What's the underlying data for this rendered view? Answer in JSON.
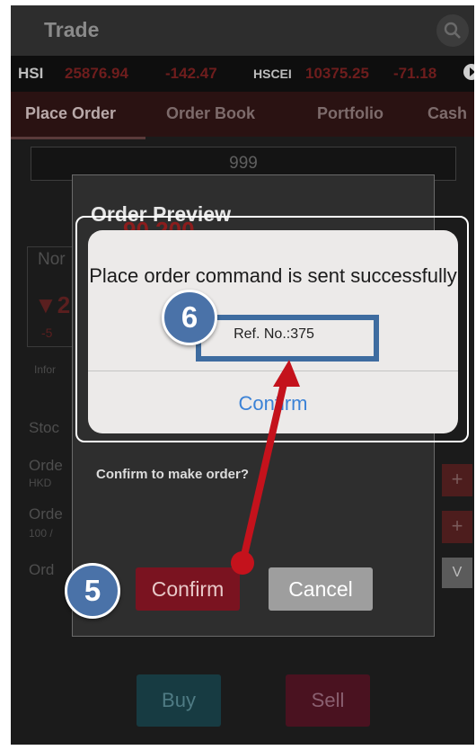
{
  "header": {
    "title": "Trade",
    "search_icon": "search-icon"
  },
  "ticker": {
    "hsi_label": "HSI",
    "hsi_value": "25876.94",
    "hsi_change": "-142.47",
    "hscei_label": "HSCEI",
    "hscei_value": "10375.25",
    "hscei_change": "-71.18",
    "more_icon": "play-icon"
  },
  "tabs": [
    {
      "label": "Place Order"
    },
    {
      "label": "Order Book"
    },
    {
      "label": "Portfolio"
    },
    {
      "label": "Cash"
    }
  ],
  "background_form": {
    "stock_code_value": "999",
    "price_display": "90.200",
    "order_type_fragment": "Nor",
    "change_fragment": "▼2",
    "change_small_fragment": "-5",
    "info_fragment": "Infor",
    "stock_label": "Stoc",
    "order_price_label": "Orde",
    "currency": "HKD",
    "order_qty_label": "Orde",
    "lot_fragment": "100 /",
    "order_type_label": "Ord",
    "plus_symbol": "+",
    "dropdown_symbol": "V",
    "buy_label": "Buy",
    "sell_label": "Sell"
  },
  "order_preview": {
    "title": "Order Preview",
    "question": "Confirm to make order?",
    "confirm_label": "Confirm",
    "cancel_label": "Cancel"
  },
  "alert": {
    "message": "Place order command is sent successfully",
    "ref": "Ref. No.:375",
    "confirm_label": "Confirm"
  },
  "annotations": {
    "step5": "5",
    "step6": "6",
    "arrow_color": "#c4121c",
    "badge_color": "#4a72a8"
  }
}
